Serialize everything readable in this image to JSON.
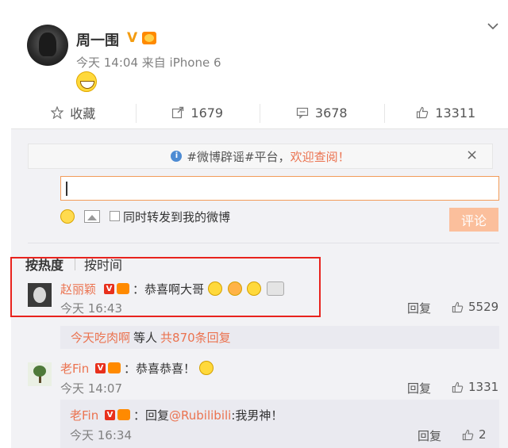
{
  "post": {
    "author": "周一围",
    "vip_mark": "V",
    "time": "今天 14:04",
    "source": "来自 iPhone 6"
  },
  "actions": {
    "favorite": "收藏",
    "repost": "1679",
    "comment": "3678",
    "like": "13311"
  },
  "comment_box": {
    "notice_prefix": "#微博辟谣#平台，",
    "notice_accent": "欢迎查阅！",
    "repost_option": "同时转发到我的微博",
    "submit": "评论"
  },
  "sort": {
    "hot": "按热度",
    "time": "按时间"
  },
  "comments": [
    {
      "name": "赵丽颖",
      "text": "：恭喜啊大哥",
      "time": "今天 16:43",
      "reply": "回复",
      "likes": "5529",
      "more_user": "今天吃肉啊",
      "more_mid": "等人",
      "more_count": "共870条回复"
    },
    {
      "name": "老Fin",
      "text": "：恭喜恭喜！",
      "time": "今天 14:07",
      "reply": "回复",
      "likes": "1331"
    }
  ],
  "sub_reply": {
    "name": "老Fin",
    "text_prefix": "：回复",
    "mention": "@Rubilibili",
    "text_suffix": ":我男神！",
    "time": "今天 16:34",
    "reply": "回复",
    "likes": "2"
  },
  "colors": {
    "accent": "#eb7350",
    "highlight": "#e8231e",
    "vip": "#f39c12"
  }
}
